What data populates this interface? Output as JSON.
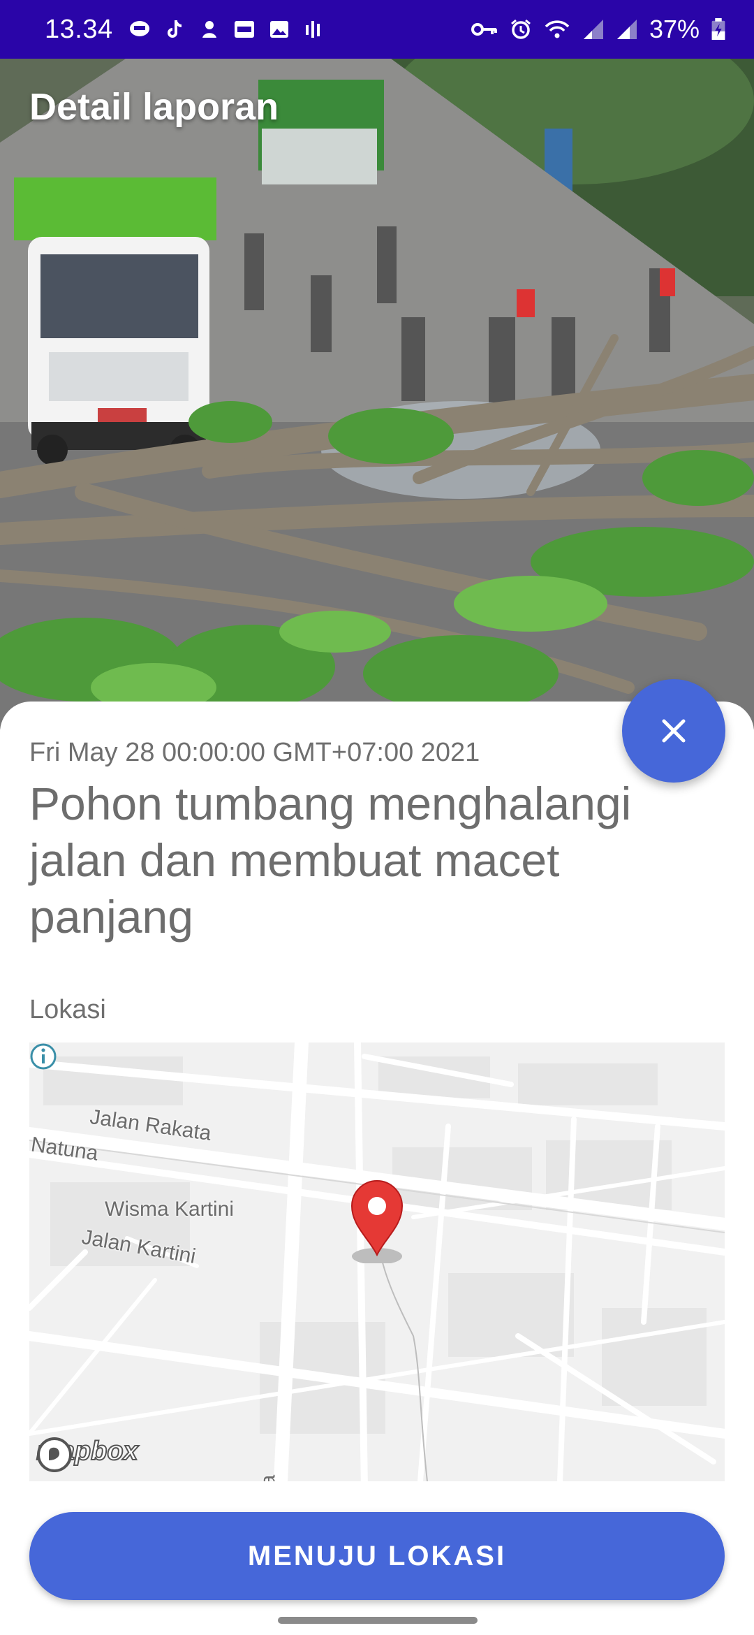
{
  "status_bar": {
    "time": "13.34",
    "battery": "37%",
    "left_icons": [
      "line-icon",
      "tiktok-icon",
      "notification-icon",
      "webtoon-icon",
      "gallery-icon",
      "voice-icon"
    ],
    "right_icons": [
      "vpn-key-icon",
      "alarm-icon",
      "wifi-icon",
      "signal-icon",
      "signal-icon",
      "battery-charging-icon"
    ]
  },
  "header": {
    "title": "Detail laporan"
  },
  "report": {
    "date": "Fri May 28 00:00:00 GMT+07:00 2021",
    "title": "Pohon tumbang menghalangi jalan dan membuat macet panjang",
    "location_label": "Lokasi"
  },
  "map": {
    "labels": {
      "street1": "Jalan Rakata",
      "street2": "Natuna",
      "place": "Wisma Kartini",
      "street3": "Jalan Kartini",
      "street4": "a"
    },
    "attribution": "mapbox"
  },
  "actions": {
    "primary_label": "MENUJU LOKASI"
  },
  "colors": {
    "status_bar": "#2a05a8",
    "accent": "#4667d9",
    "marker": "#e53935"
  }
}
